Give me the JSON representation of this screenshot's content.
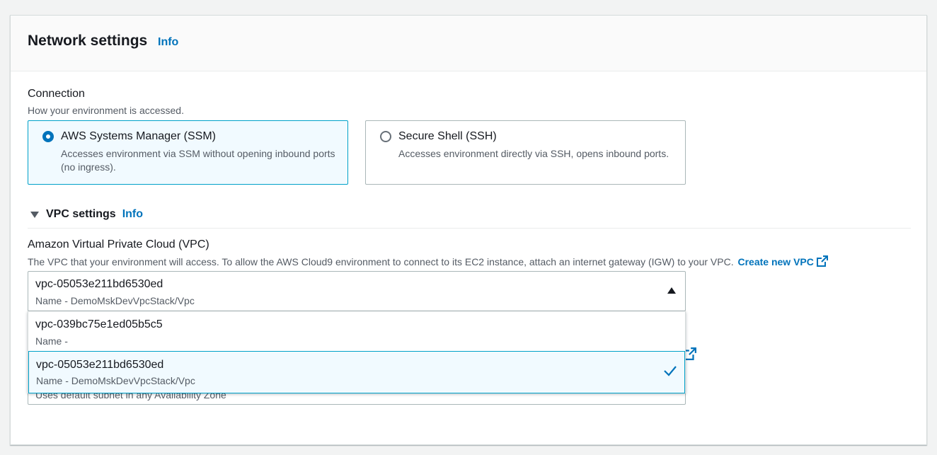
{
  "header": {
    "title": "Network settings",
    "info": "Info"
  },
  "connection": {
    "label": "Connection",
    "description": "How your environment is accessed.",
    "options": [
      {
        "title": "AWS Systems Manager (SSM)",
        "description": "Accesses environment via SSM without opening inbound ports (no ingress).",
        "selected": true
      },
      {
        "title": "Secure Shell (SSH)",
        "description": "Accesses environment directly via SSH, opens inbound ports.",
        "selected": false
      }
    ]
  },
  "vpc_settings": {
    "label": "VPC settings",
    "info": "Info",
    "expanded": true
  },
  "vpc": {
    "label": "Amazon Virtual Private Cloud (VPC)",
    "description": "The VPC that your environment will access. To allow the AWS Cloud9 environment to connect to its EC2 instance, attach an internet gateway (IGW) to your VPC.",
    "create_link": "Create new VPC",
    "selected_value": "vpc-05053e211bd6530ed",
    "selected_name": "Name - DemoMskDevVpcStack/Vpc",
    "options": [
      {
        "value": "vpc-039bc75e1ed05b5c5",
        "name": "Name -",
        "selected": false
      },
      {
        "value": "vpc-05053e211bd6530ed",
        "name": "Name - DemoMskDevVpcStack/Vpc",
        "selected": true
      }
    ]
  },
  "subnet": {
    "hidden_hint": "Uses default subnet in any Availability Zone"
  },
  "colors": {
    "link": "#0073bb",
    "selected_border": "#00a1c9",
    "selected_bg": "#f1faff",
    "check": "#0073bb"
  }
}
